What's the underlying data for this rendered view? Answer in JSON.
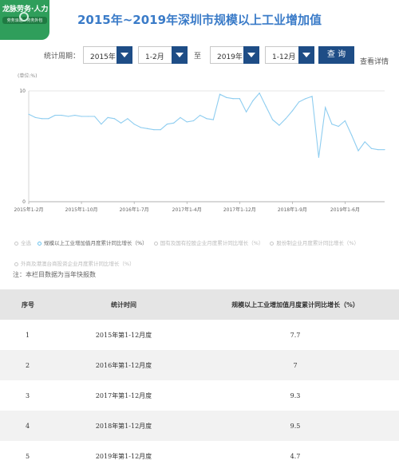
{
  "logo": {
    "line1": "龙脉劳务·人力",
    "line2": "劳务派遣 · 劳务外包"
  },
  "page_title": "2015年~2019年深圳市规模以上工业增加值",
  "filters": {
    "period_label": "统计周期：",
    "start_year": "2015年",
    "start_month": "1-2月",
    "to_label": "至",
    "end_year": "2019年",
    "end_month": "1-12月",
    "query_button": "查 询",
    "details_link": "查看详情"
  },
  "legend_items": [
    {
      "label": "全选",
      "active": false
    },
    {
      "label": "规模以上工业增加值月度累计同比增长（%）",
      "active": true
    },
    {
      "label": "国有及国有控股企业月度累计同比增长（%）",
      "active": false
    },
    {
      "label": "股份制企业月度累计同比增长（%）",
      "active": false
    },
    {
      "label": "外商及港澳台商投资企业月度累计同比增长（%）",
      "active": false
    }
  ],
  "note": "注：本栏目数据为当年快报数",
  "chart_data": {
    "type": "line",
    "ylabel": "(单位:%)",
    "ylim": [
      0,
      10
    ],
    "yticks": [
      0,
      10
    ],
    "grid": true,
    "line_color": "#8ecdf0",
    "x_ticks": [
      "2015年1-2月",
      "2015年1-10月",
      "2016年1-7月",
      "2017年1-4月",
      "2017年1-12月",
      "2018年1-9月",
      "2019年1-6月"
    ],
    "x": [
      "2015-02",
      "2015-03",
      "2015-04",
      "2015-05",
      "2015-06",
      "2015-07",
      "2015-08",
      "2015-09",
      "2015-10",
      "2015-11",
      "2015-12",
      "2016-02",
      "2016-03",
      "2016-04",
      "2016-05",
      "2016-06",
      "2016-07",
      "2016-08",
      "2016-09",
      "2016-10",
      "2016-11",
      "2016-12",
      "2017-02",
      "2017-03",
      "2017-04",
      "2017-05",
      "2017-06",
      "2017-07",
      "2017-08",
      "2017-09",
      "2017-10",
      "2017-11",
      "2017-12",
      "2018-02",
      "2018-03",
      "2018-04",
      "2018-05",
      "2018-06",
      "2018-07",
      "2018-08",
      "2018-09",
      "2018-10",
      "2018-11",
      "2018-12",
      "2019-02",
      "2019-03",
      "2019-04",
      "2019-05",
      "2019-06",
      "2019-07",
      "2019-08",
      "2019-09",
      "2019-10",
      "2019-11",
      "2019-12"
    ],
    "series": [
      {
        "name": "规模以上工业增加值月度累计同比增长（%）",
        "values": [
          7.9,
          7.6,
          7.5,
          7.5,
          7.8,
          7.8,
          7.7,
          7.8,
          7.7,
          7.7,
          7.7,
          7.0,
          7.6,
          7.5,
          7.1,
          7.5,
          7.0,
          6.7,
          6.6,
          6.5,
          6.5,
          7.0,
          7.1,
          7.6,
          7.2,
          7.3,
          7.8,
          7.5,
          7.4,
          9.7,
          9.4,
          9.3,
          9.3,
          8.1,
          9.1,
          9.8,
          8.6,
          7.4,
          6.9,
          7.5,
          8.2,
          9.0,
          9.3,
          9.5,
          4.0,
          8.5,
          7.0,
          6.8,
          7.3,
          6.0,
          4.6,
          5.4,
          4.8,
          4.7,
          4.7
        ]
      }
    ]
  },
  "table": {
    "headers": [
      "序号",
      "统计时间",
      "规模以上工业增加值月度累计同比增长（%）"
    ],
    "rows": [
      {
        "no": "1",
        "period": "2015年第1-12月度",
        "value": "7.7"
      },
      {
        "no": "2",
        "period": "2016年第1-12月度",
        "value": "7"
      },
      {
        "no": "3",
        "period": "2017年第1-12月度",
        "value": "9.3"
      },
      {
        "no": "4",
        "period": "2018年第1-12月度",
        "value": "9.5"
      },
      {
        "no": "5",
        "period": "2019年第1-12月度",
        "value": "4.7"
      }
    ]
  }
}
